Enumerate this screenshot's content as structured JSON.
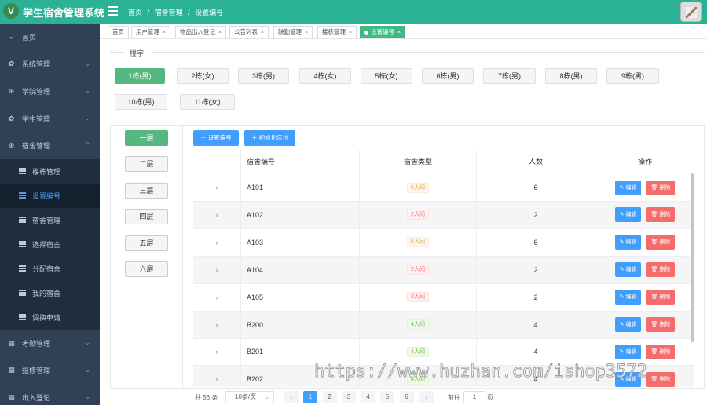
{
  "app": {
    "title": "学生宿舍管理系统",
    "logo_letter": "V"
  },
  "header": {
    "breadcrumb": [
      "首页",
      "宿舍管理",
      "设置编号"
    ],
    "separator": "/"
  },
  "sidebar": {
    "items": [
      {
        "label": "首页",
        "icon": "dashboard-icon"
      },
      {
        "label": "系统管理",
        "icon": "gear-icon"
      },
      {
        "label": "学院管理",
        "icon": "plus-circle-icon"
      },
      {
        "label": "学生管理",
        "icon": "gear-icon"
      },
      {
        "label": "宿舍管理",
        "icon": "plus-circle-icon"
      },
      {
        "label": "楼栋管理",
        "sub": true
      },
      {
        "label": "设置编号",
        "sub": true,
        "active": true
      },
      {
        "label": "宿舍管理",
        "sub": true
      },
      {
        "label": "选择宿舍",
        "sub": true
      },
      {
        "label": "分配宿舍",
        "sub": true
      },
      {
        "label": "我的宿舍",
        "sub": true
      },
      {
        "label": "调换申请",
        "sub": true
      },
      {
        "label": "考勤管理",
        "icon": "table-icon"
      },
      {
        "label": "报修管理",
        "icon": "table-icon"
      },
      {
        "label": "出入登记",
        "icon": "table-icon"
      }
    ]
  },
  "tabs": [
    {
      "label": "首页"
    },
    {
      "label": "用户管理",
      "x": "×"
    },
    {
      "label": "物品出入登记",
      "x": "×"
    },
    {
      "label": "公告列表",
      "x": "×"
    },
    {
      "label": "缺勤管理",
      "x": "×"
    },
    {
      "label": "楼栋管理",
      "x": "×"
    },
    {
      "label": "设置编号",
      "x": "×",
      "active": true
    }
  ],
  "buildings": {
    "title": "楼宇",
    "items": [
      "1栋(男)",
      "2栋(女)",
      "3栋(男)",
      "4栋(女)",
      "5栋(女)",
      "6栋(男)",
      "7栋(男)",
      "8栋(男)",
      "9栋(男)",
      "10栋(男)",
      "11栋(女)"
    ],
    "selected": "1栋(男)"
  },
  "floors": {
    "items": [
      "一层",
      "二层",
      "三层",
      "四层",
      "五层",
      "六层"
    ],
    "selected": "一层"
  },
  "actions": {
    "set_number": "设置编号",
    "init_beds": "初始化床位"
  },
  "table": {
    "headers": [
      "",
      "宿舍编号",
      "宿舍类型",
      "人数",
      "操作"
    ],
    "expand_glyph": "›",
    "edit_label": "编辑",
    "delete_label": "删除",
    "rows": [
      {
        "number": "A101",
        "type": "6人间",
        "count": "6"
      },
      {
        "number": "A102",
        "type": "2人间",
        "count": "2"
      },
      {
        "number": "A103",
        "type": "6人间",
        "count": "6"
      },
      {
        "number": "A104",
        "type": "2人间",
        "count": "2"
      },
      {
        "number": "A105",
        "type": "2人间",
        "count": "2"
      },
      {
        "number": "B200",
        "type": "4人间",
        "count": "4"
      },
      {
        "number": "B201",
        "type": "4人间",
        "count": "4"
      },
      {
        "number": "B202",
        "type": "4人间",
        "count": "4"
      }
    ]
  },
  "pagination": {
    "total": "共 56 条",
    "page_size": "10条/页",
    "prev": "‹",
    "next": "›",
    "pages": [
      "1",
      "2",
      "3",
      "4",
      "5",
      "6"
    ],
    "current": "1",
    "goto_label": "前往",
    "goto_value": "1",
    "page_suffix": "页"
  },
  "watermark": "https://www.huzhan.com/ishop3572",
  "colors": {
    "topbar": "#2bb294",
    "sidebar": "#304156",
    "primary": "#409eff",
    "success": "#56b881",
    "danger": "#f56c6c"
  }
}
